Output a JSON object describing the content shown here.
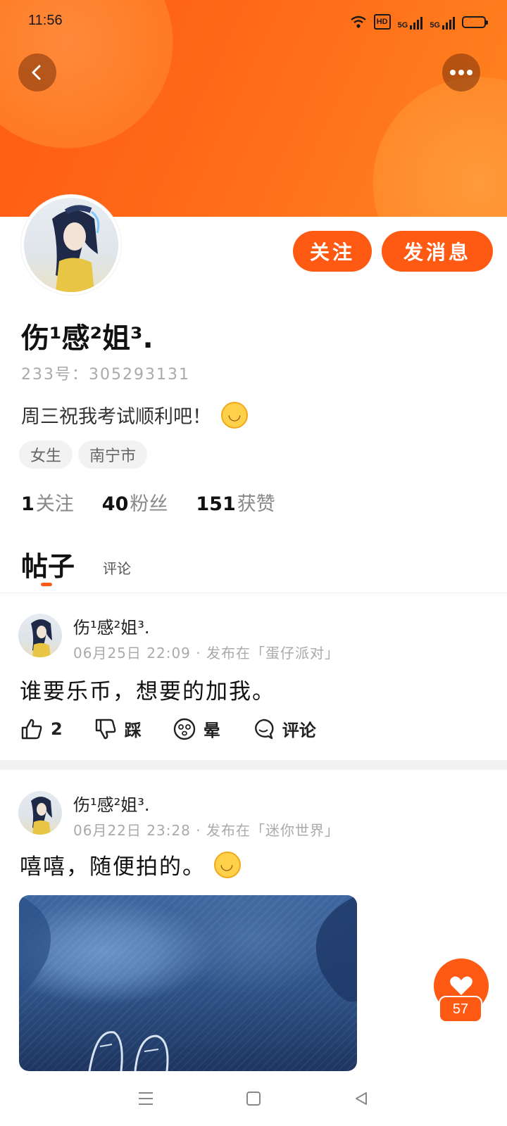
{
  "status_bar": {
    "time": "11:56",
    "icons": [
      "wifi-icon",
      "hd-icon",
      "5g-signal-icon",
      "5g-signal-icon",
      "battery-icon"
    ],
    "hd_label": "HD",
    "net1": "5G",
    "net2": "5G"
  },
  "header": {
    "back_icon": "back-arrow-icon",
    "more_icon": "more-dots-icon",
    "banner_color": "#ff6a18"
  },
  "profile": {
    "username": "伤¹感²姐³.",
    "uid": "233号：305293131",
    "bio": "周三祝我考试顺利吧！",
    "bio_emoji": "smile-emoji",
    "tags": [
      "女生",
      "南宁市"
    ],
    "stats": [
      {
        "value": "1",
        "label": "关注"
      },
      {
        "value": "40",
        "label": "粉丝"
      },
      {
        "value": "151",
        "label": "获赞"
      }
    ],
    "follow_label": "关注",
    "message_label": "发消息"
  },
  "tabs": [
    {
      "label": "帖子",
      "active": true
    },
    {
      "label": "评论",
      "active": false
    }
  ],
  "posts": [
    {
      "author": "伤¹感²姐³.",
      "meta": "06月25日 22:09 · 发布在「蛋仔派对」",
      "text": "谁要乐币，想要的加我。",
      "actions": {
        "like_count": "2",
        "dislike_label": "踩",
        "dizzy_label": "晕",
        "comment_label": "评论"
      }
    },
    {
      "author": "伤¹感²姐³.",
      "meta": "06月22日 23:28 · 发布在「迷你世界」",
      "text": "嘻嘻，随便拍的。",
      "has_emoji": true,
      "has_image": true
    }
  ],
  "fab": {
    "icon": "heart-icon",
    "count": "57"
  },
  "navbar": {
    "icons": [
      "menu-icon",
      "home-square-icon",
      "back-triangle-icon"
    ]
  },
  "colors": {
    "accent": "#ff5a14",
    "tag_bg": "#f2f2f2",
    "meta_text": "#aaaaaa"
  }
}
